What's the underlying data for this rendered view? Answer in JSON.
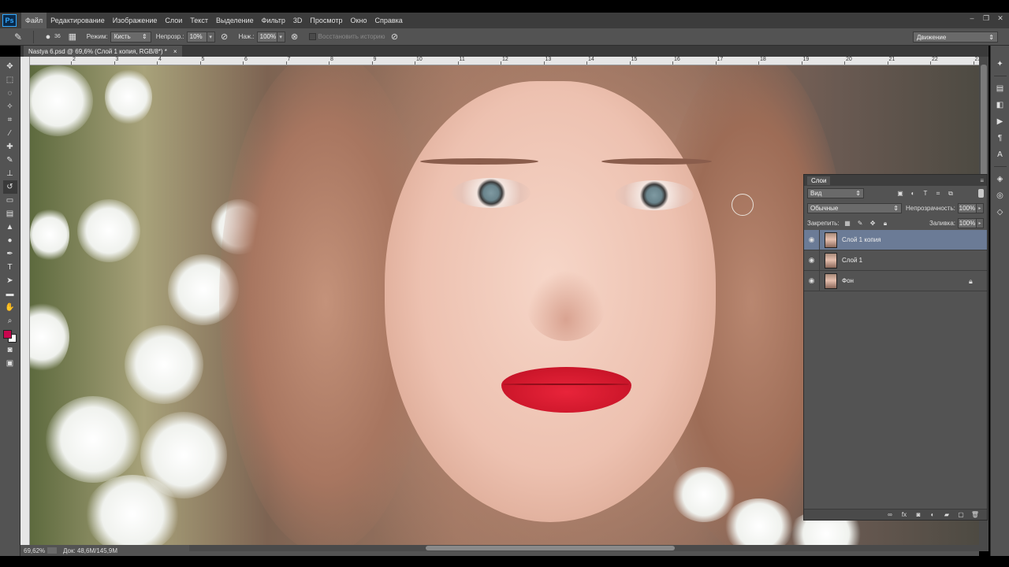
{
  "colors": {
    "foreground": "#c8064e",
    "background": "#ffffff",
    "selected_layer": "#6b7b96"
  },
  "app": {
    "logo": "Ps"
  },
  "menu": [
    "Файл",
    "Редактирование",
    "Изображение",
    "Слои",
    "Текст",
    "Выделение",
    "Фильтр",
    "3D",
    "Просмотр",
    "Окно",
    "Справка"
  ],
  "window_controls": {
    "minimize": "–",
    "restore": "❐",
    "close": "✕"
  },
  "options": {
    "brush_size": "36",
    "mode_label": "Режим:",
    "mode_value": "Кисть",
    "opacity_label": "Непрозр.:",
    "opacity_value": "10%",
    "flow_label": "Наж.:",
    "flow_value": "100%",
    "history_label": "Восстановить историю",
    "workspace": "Движение"
  },
  "document": {
    "tab_title": "Nastya 6.psd @ 69,6% (Слой 1 копия, RGB/8*) *",
    "close": "×"
  },
  "ruler": [
    "2",
    "4",
    "6",
    "8",
    "10",
    "12",
    "14",
    "16",
    "18",
    "20",
    "22",
    "3",
    "5",
    "7",
    "9",
    "11",
    "13",
    "15",
    "17",
    "19",
    "21",
    "23"
  ],
  "status": {
    "zoom": "69,62%",
    "doc": "Док: 48,6M/145,9M"
  },
  "layers_panel": {
    "tab": "Слои",
    "filter_kind": "Вид",
    "blend_mode": "Обычные",
    "opacity_label": "Непрозрачность:",
    "opacity_value": "100%",
    "lock_label": "Закрепить:",
    "fill_label": "Заливка:",
    "fill_value": "100%",
    "layers": [
      {
        "name": "Слой 1 копия",
        "visible": true,
        "selected": true
      },
      {
        "name": "Слой 1",
        "visible": true,
        "selected": false
      },
      {
        "name": "Фон",
        "visible": true,
        "selected": false,
        "locked": true
      }
    ]
  }
}
